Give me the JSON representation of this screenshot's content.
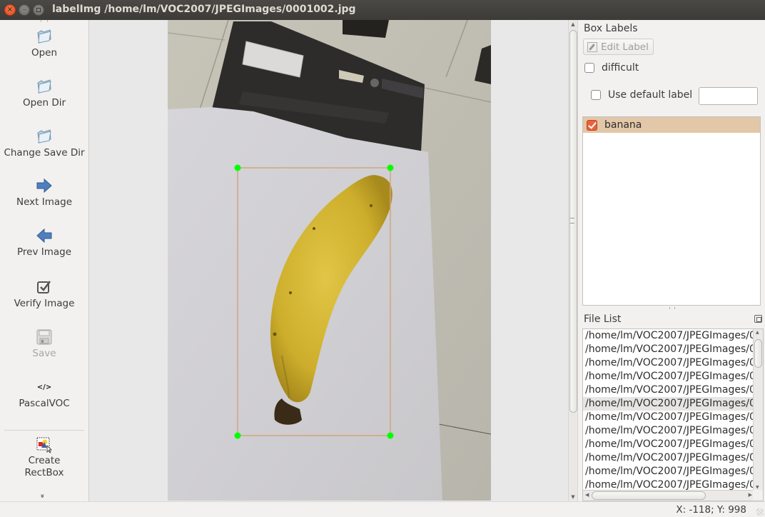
{
  "window": {
    "title": "labelImg /home/lm/VOC2007/JPEGImages/0001002.jpg",
    "controls": [
      "close",
      "minimize",
      "maximize"
    ]
  },
  "toolbar": {
    "items": [
      {
        "label": "Open",
        "icon": "folder-open-icon",
        "enabled": true
      },
      {
        "label": "Open Dir",
        "icon": "folder-open-icon",
        "enabled": true
      },
      {
        "label": "Change Save Dir",
        "icon": "folder-open-icon",
        "enabled": true
      },
      {
        "label": "Next Image",
        "icon": "arrow-right-icon",
        "enabled": true
      },
      {
        "label": "Prev Image",
        "icon": "arrow-left-icon",
        "enabled": true
      },
      {
        "label": "Verify Image",
        "icon": "checkbox-icon",
        "enabled": true
      },
      {
        "label": "Save",
        "icon": "floppy-disk-icon",
        "enabled": false
      },
      {
        "label": "PascalVOC",
        "icon": "code-tag-icon",
        "enabled": true
      },
      {
        "label": "Create\nRectBox",
        "icon": "create-rect-icon",
        "enabled": true
      }
    ],
    "code_glyph": "</>",
    "more_glyph": "»"
  },
  "canvas": {
    "image_file": "0001002.jpg",
    "annotation": {
      "label": "banana",
      "box_color": "#d3a57c",
      "handle_color": "#00ff00"
    }
  },
  "box_labels": {
    "title": "Box Labels",
    "edit_label_button": "Edit Label",
    "difficult": {
      "label": "difficult",
      "checked": false
    },
    "use_default_label": {
      "label": "Use default label",
      "checked": false,
      "value": ""
    },
    "items": [
      {
        "label": "banana",
        "checked": true,
        "color": "#e2c7a8"
      }
    ]
  },
  "file_list": {
    "title": "File List",
    "items": [
      "/home/lm/VOC2007/JPEGImages/0",
      "/home/lm/VOC2007/JPEGImages/0",
      "/home/lm/VOC2007/JPEGImages/0",
      "/home/lm/VOC2007/JPEGImages/0",
      "/home/lm/VOC2007/JPEGImages/0",
      "/home/lm/VOC2007/JPEGImages/0",
      "/home/lm/VOC2007/JPEGImages/0",
      "/home/lm/VOC2007/JPEGImages/0",
      "/home/lm/VOC2007/JPEGImages/0",
      "/home/lm/VOC2007/JPEGImages/0",
      "/home/lm/VOC2007/JPEGImages/0",
      "/home/lm/VOC2007/JPEGImages/0"
    ],
    "selected_index": 5
  },
  "status": {
    "text": "X: -118; Y: 998"
  }
}
